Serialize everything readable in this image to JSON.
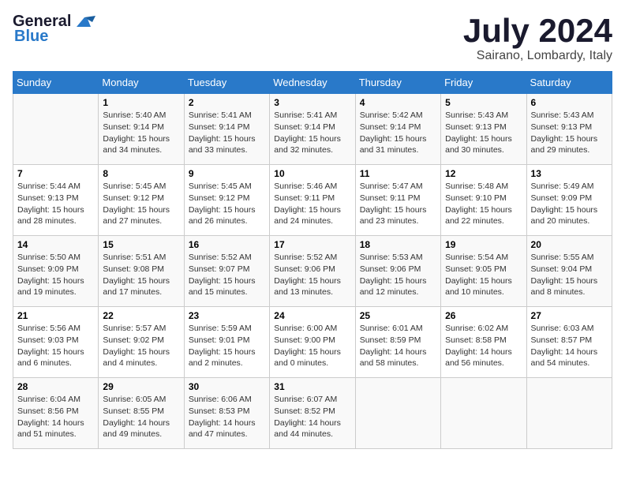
{
  "header": {
    "logo_line1": "General",
    "logo_line2": "Blue",
    "month_title": "July 2024",
    "location": "Sairano, Lombardy, Italy"
  },
  "weekdays": [
    "Sunday",
    "Monday",
    "Tuesday",
    "Wednesday",
    "Thursday",
    "Friday",
    "Saturday"
  ],
  "weeks": [
    [
      {
        "day": "",
        "info": ""
      },
      {
        "day": "1",
        "info": "Sunrise: 5:40 AM\nSunset: 9:14 PM\nDaylight: 15 hours\nand 34 minutes."
      },
      {
        "day": "2",
        "info": "Sunrise: 5:41 AM\nSunset: 9:14 PM\nDaylight: 15 hours\nand 33 minutes."
      },
      {
        "day": "3",
        "info": "Sunrise: 5:41 AM\nSunset: 9:14 PM\nDaylight: 15 hours\nand 32 minutes."
      },
      {
        "day": "4",
        "info": "Sunrise: 5:42 AM\nSunset: 9:14 PM\nDaylight: 15 hours\nand 31 minutes."
      },
      {
        "day": "5",
        "info": "Sunrise: 5:43 AM\nSunset: 9:13 PM\nDaylight: 15 hours\nand 30 minutes."
      },
      {
        "day": "6",
        "info": "Sunrise: 5:43 AM\nSunset: 9:13 PM\nDaylight: 15 hours\nand 29 minutes."
      }
    ],
    [
      {
        "day": "7",
        "info": "Sunrise: 5:44 AM\nSunset: 9:13 PM\nDaylight: 15 hours\nand 28 minutes."
      },
      {
        "day": "8",
        "info": "Sunrise: 5:45 AM\nSunset: 9:12 PM\nDaylight: 15 hours\nand 27 minutes."
      },
      {
        "day": "9",
        "info": "Sunrise: 5:45 AM\nSunset: 9:12 PM\nDaylight: 15 hours\nand 26 minutes."
      },
      {
        "day": "10",
        "info": "Sunrise: 5:46 AM\nSunset: 9:11 PM\nDaylight: 15 hours\nand 24 minutes."
      },
      {
        "day": "11",
        "info": "Sunrise: 5:47 AM\nSunset: 9:11 PM\nDaylight: 15 hours\nand 23 minutes."
      },
      {
        "day": "12",
        "info": "Sunrise: 5:48 AM\nSunset: 9:10 PM\nDaylight: 15 hours\nand 22 minutes."
      },
      {
        "day": "13",
        "info": "Sunrise: 5:49 AM\nSunset: 9:09 PM\nDaylight: 15 hours\nand 20 minutes."
      }
    ],
    [
      {
        "day": "14",
        "info": "Sunrise: 5:50 AM\nSunset: 9:09 PM\nDaylight: 15 hours\nand 19 minutes."
      },
      {
        "day": "15",
        "info": "Sunrise: 5:51 AM\nSunset: 9:08 PM\nDaylight: 15 hours\nand 17 minutes."
      },
      {
        "day": "16",
        "info": "Sunrise: 5:52 AM\nSunset: 9:07 PM\nDaylight: 15 hours\nand 15 minutes."
      },
      {
        "day": "17",
        "info": "Sunrise: 5:52 AM\nSunset: 9:06 PM\nDaylight: 15 hours\nand 13 minutes."
      },
      {
        "day": "18",
        "info": "Sunrise: 5:53 AM\nSunset: 9:06 PM\nDaylight: 15 hours\nand 12 minutes."
      },
      {
        "day": "19",
        "info": "Sunrise: 5:54 AM\nSunset: 9:05 PM\nDaylight: 15 hours\nand 10 minutes."
      },
      {
        "day": "20",
        "info": "Sunrise: 5:55 AM\nSunset: 9:04 PM\nDaylight: 15 hours\nand 8 minutes."
      }
    ],
    [
      {
        "day": "21",
        "info": "Sunrise: 5:56 AM\nSunset: 9:03 PM\nDaylight: 15 hours\nand 6 minutes."
      },
      {
        "day": "22",
        "info": "Sunrise: 5:57 AM\nSunset: 9:02 PM\nDaylight: 15 hours\nand 4 minutes."
      },
      {
        "day": "23",
        "info": "Sunrise: 5:59 AM\nSunset: 9:01 PM\nDaylight: 15 hours\nand 2 minutes."
      },
      {
        "day": "24",
        "info": "Sunrise: 6:00 AM\nSunset: 9:00 PM\nDaylight: 15 hours\nand 0 minutes."
      },
      {
        "day": "25",
        "info": "Sunrise: 6:01 AM\nSunset: 8:59 PM\nDaylight: 14 hours\nand 58 minutes."
      },
      {
        "day": "26",
        "info": "Sunrise: 6:02 AM\nSunset: 8:58 PM\nDaylight: 14 hours\nand 56 minutes."
      },
      {
        "day": "27",
        "info": "Sunrise: 6:03 AM\nSunset: 8:57 PM\nDaylight: 14 hours\nand 54 minutes."
      }
    ],
    [
      {
        "day": "28",
        "info": "Sunrise: 6:04 AM\nSunset: 8:56 PM\nDaylight: 14 hours\nand 51 minutes."
      },
      {
        "day": "29",
        "info": "Sunrise: 6:05 AM\nSunset: 8:55 PM\nDaylight: 14 hours\nand 49 minutes."
      },
      {
        "day": "30",
        "info": "Sunrise: 6:06 AM\nSunset: 8:53 PM\nDaylight: 14 hours\nand 47 minutes."
      },
      {
        "day": "31",
        "info": "Sunrise: 6:07 AM\nSunset: 8:52 PM\nDaylight: 14 hours\nand 44 minutes."
      },
      {
        "day": "",
        "info": ""
      },
      {
        "day": "",
        "info": ""
      },
      {
        "day": "",
        "info": ""
      }
    ]
  ]
}
